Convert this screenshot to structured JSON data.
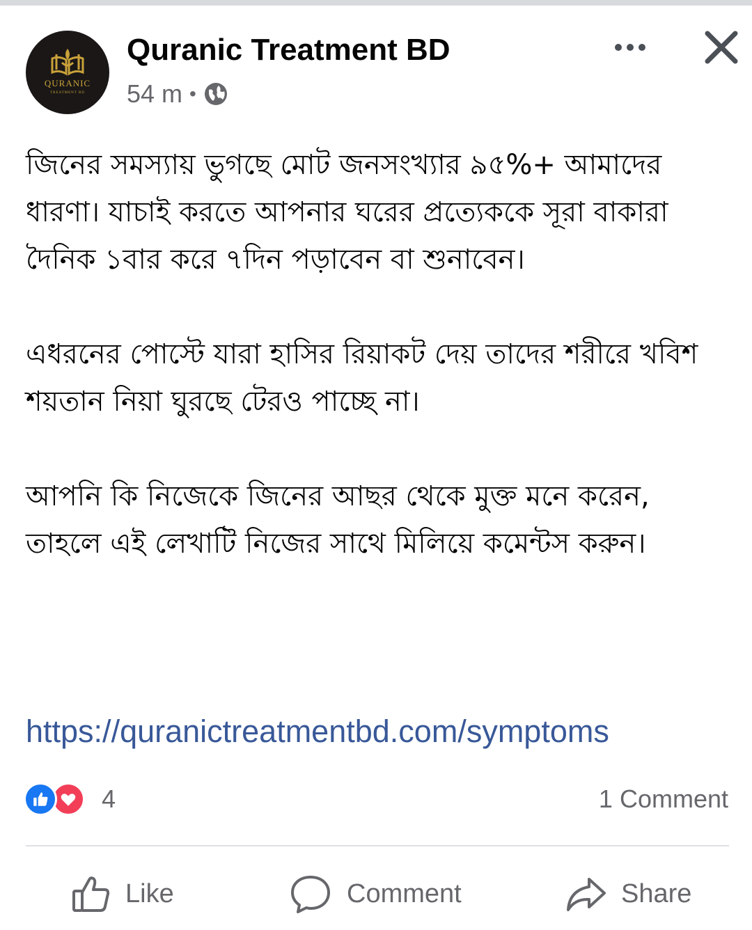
{
  "post": {
    "author": "Quranic Treatment BD",
    "avatar_logo_text": "QURANIC",
    "avatar_logo_subtext": "TREATMENT BD",
    "time": "54 m",
    "separator": "•",
    "privacy_icon": "globe-icon",
    "paragraphs": [
      "জিনের সমস্যায় ভুগছে মোট জনসংখ্যার ৯৫%+ আমাদের ধারণা। যাচাই করতে আপনার ঘরের প্রত্যেককে সূরা বাকারা দৈনিক ১বার করে ৭দিন পড়াবেন বা শুনাবেন।",
      "এধরনের পোস্টে যারা হাসির রিয়াকট দেয় তাদের শরীরে খবিশ শয়তান নিয়া ঘুরছে টেরও পাচ্ছে না।",
      "আপনি কি নিজেকে জিনের আছর থেকে মুক্ত মনে করেন, তাহলে এই লেখাটি নিজের সাথে মিলিয়ে কমেন্টস করুন।"
    ],
    "link": "https://quranictreatmentbd.com/symptoms"
  },
  "stats": {
    "reaction_count": "4",
    "reaction_icons": [
      "like-reaction-icon",
      "love-reaction-icon"
    ],
    "comments": "1 Comment"
  },
  "actions": {
    "like_label": "Like",
    "comment_label": "Comment",
    "share_label": "Share"
  },
  "colors": {
    "link": "#385898",
    "secondary_text": "#65676b",
    "like_blue": "#1877f2",
    "love_red": "#f33e58",
    "avatar_bg": "#1a1716",
    "logo_gold": "#c9a23a"
  }
}
